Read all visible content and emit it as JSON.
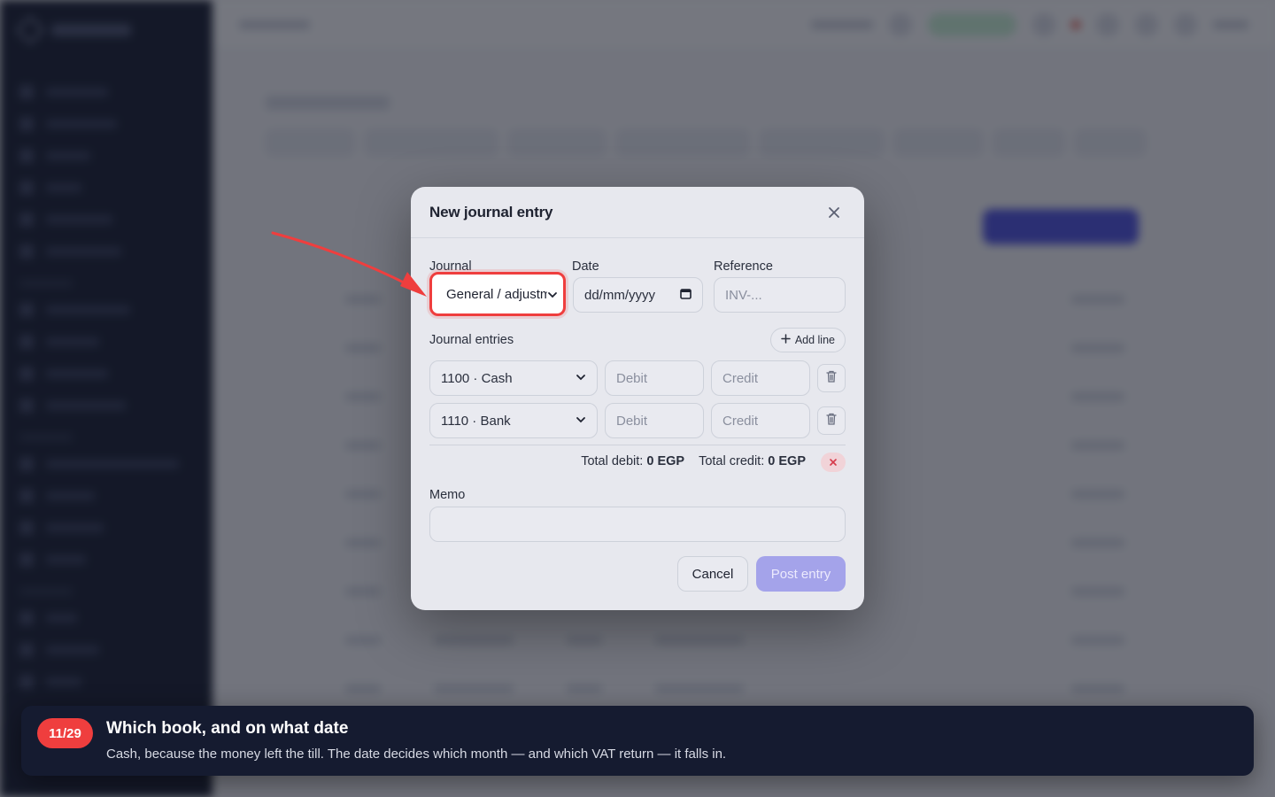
{
  "modal": {
    "title": "New journal entry",
    "close_icon": "close-icon",
    "journal": {
      "label": "Journal",
      "value": "General / adjustm"
    },
    "date": {
      "label": "Date",
      "placeholder": "dd/mm/yyyy"
    },
    "reference": {
      "label": "Reference",
      "placeholder": "INV-..."
    },
    "entries_label": "Journal entries",
    "add_line_label": "Add line",
    "lines": [
      {
        "account": "1100 · Cash",
        "debit_placeholder": "Debit",
        "credit_placeholder": "Credit"
      },
      {
        "account": "1110 · Bank",
        "debit_placeholder": "Debit",
        "credit_placeholder": "Credit"
      }
    ],
    "totals": {
      "debit_label": "Total debit:",
      "debit_value": "0 EGP",
      "credit_label": "Total credit:",
      "credit_value": "0 EGP"
    },
    "memo_label": "Memo",
    "cancel_label": "Cancel",
    "post_label": "Post entry"
  },
  "tour": {
    "step": "11/29",
    "title": "Which book, and on what date",
    "body": "Cash, because the money left the till. The date decides which month — and which VAT return — it falls in."
  },
  "colors": {
    "highlight": "#ef3e3e",
    "primary_disabled": "#a4a3ea",
    "tour_background": "#151b30"
  }
}
